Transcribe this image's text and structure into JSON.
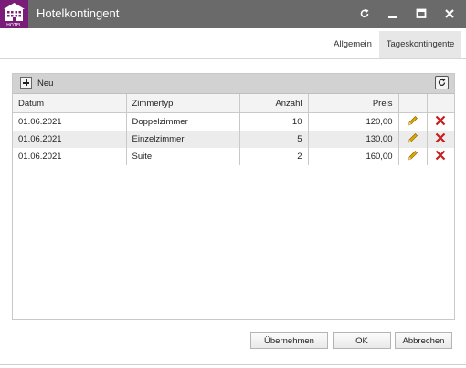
{
  "window": {
    "title": "Hotelkontingent",
    "logo_text": "HOTEL",
    "controls": [
      "refresh-icon",
      "minimize-icon",
      "maximize-icon",
      "close-icon"
    ]
  },
  "tabs": [
    {
      "label": "Allgemein",
      "active": false
    },
    {
      "label": "Tageskontingente",
      "active": true
    }
  ],
  "toolbar": {
    "add_label": "Neu"
  },
  "table": {
    "columns": [
      "Datum",
      "Zimmertyp",
      "Anzahl",
      "Preis",
      "",
      ""
    ],
    "rows": [
      {
        "datum": "01.06.2021",
        "zimmertyp": "Doppelzimmer",
        "anzahl": "10",
        "preis": "120,00"
      },
      {
        "datum": "01.06.2021",
        "zimmertyp": "Einzelzimmer",
        "anzahl": "5",
        "preis": "130,00"
      },
      {
        "datum": "01.06.2021",
        "zimmertyp": "Suite",
        "anzahl": "2",
        "preis": "160,00"
      }
    ]
  },
  "buttons": {
    "apply": "Übernehmen",
    "ok": "OK",
    "cancel": "Abbrechen"
  },
  "colors": {
    "titlebar": "#6a6a6a",
    "brand": "#7a1d78",
    "edit": "#e0a800",
    "delete": "#c81e1e"
  }
}
